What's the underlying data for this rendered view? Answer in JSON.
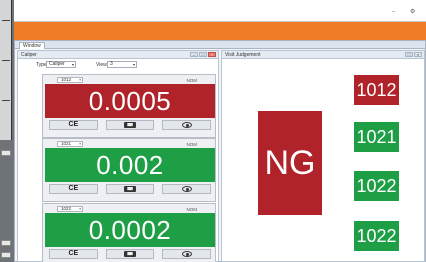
{
  "window": {
    "tab_label": "Window",
    "controls": [
      "–",
      "□",
      "×"
    ]
  },
  "left_panel": {
    "title": "Caliper",
    "type_label": "Type",
    "type_value": "Caliper",
    "view_label": "View",
    "view_value": "3"
  },
  "right_panel": {
    "title": "Visit Judgement"
  },
  "cards": [
    {
      "id": "1012",
      "nom_label": "NOM",
      "value": "0.0005",
      "status": "ng",
      "color": "#b0232a",
      "ce_label": "CE"
    },
    {
      "id": "1021",
      "nom_label": "NOM",
      "value": "0.002",
      "status": "ok",
      "color": "#1e9e45",
      "ce_label": "CE"
    },
    {
      "id": "1022",
      "nom_label": "NOM",
      "value": "0.0002",
      "status": "ok",
      "color": "#1e9e45",
      "ce_label": "CE"
    }
  ],
  "judgement": {
    "overall": "NG",
    "overall_color": "#b0232a",
    "items": [
      {
        "label": "1012",
        "color": "#b0232a"
      },
      {
        "label": "1021",
        "color": "#1e9e45"
      },
      {
        "label": "1022",
        "color": "#1e9e45"
      },
      {
        "label": "1022",
        "color": "#1e9e45"
      }
    ]
  },
  "icons": {
    "keyboard": "keyboard-icon",
    "eye": "eye-icon",
    "dropdown": "chevron-down-icon"
  }
}
